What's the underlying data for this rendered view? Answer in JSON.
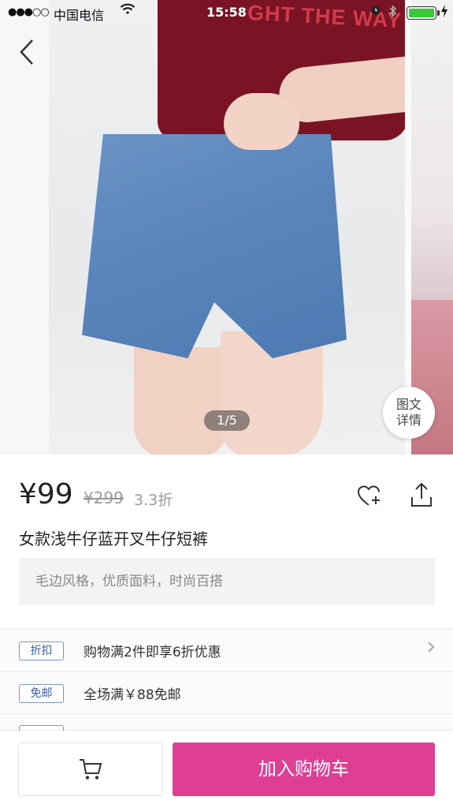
{
  "status_bar": {
    "signal": "●●●○○",
    "carrier": "中国电信",
    "time": "15:58"
  },
  "hero": {
    "shirt_print": "GHT THE WAY",
    "pager": "1/5",
    "detail_badge_line1": "图文",
    "detail_badge_line2": "详情"
  },
  "product": {
    "price": "¥99",
    "original_price": "¥299",
    "discount": "3.3折",
    "title": "女款浅牛仔蓝开叉牛仔短裤",
    "description": "毛边风格，优质面料，时尚百搭"
  },
  "promotions": [
    {
      "tag": "折扣",
      "text": "购物满2件即享6折优惠"
    },
    {
      "tag": "免邮",
      "text": "全场满￥88免邮"
    }
  ],
  "bottom_bar": {
    "add_to_cart_label": "加入购物车"
  },
  "colors": {
    "accent": "#de3f93",
    "tag_border": "#7b96c8",
    "battery": "#39c83a"
  },
  "icons": [
    "back-icon",
    "cart-icon",
    "favorite-add-icon",
    "share-icon",
    "wifi-icon",
    "alarm-icon",
    "bluetooth-icon",
    "battery-icon",
    "chevron-right-icon"
  ]
}
